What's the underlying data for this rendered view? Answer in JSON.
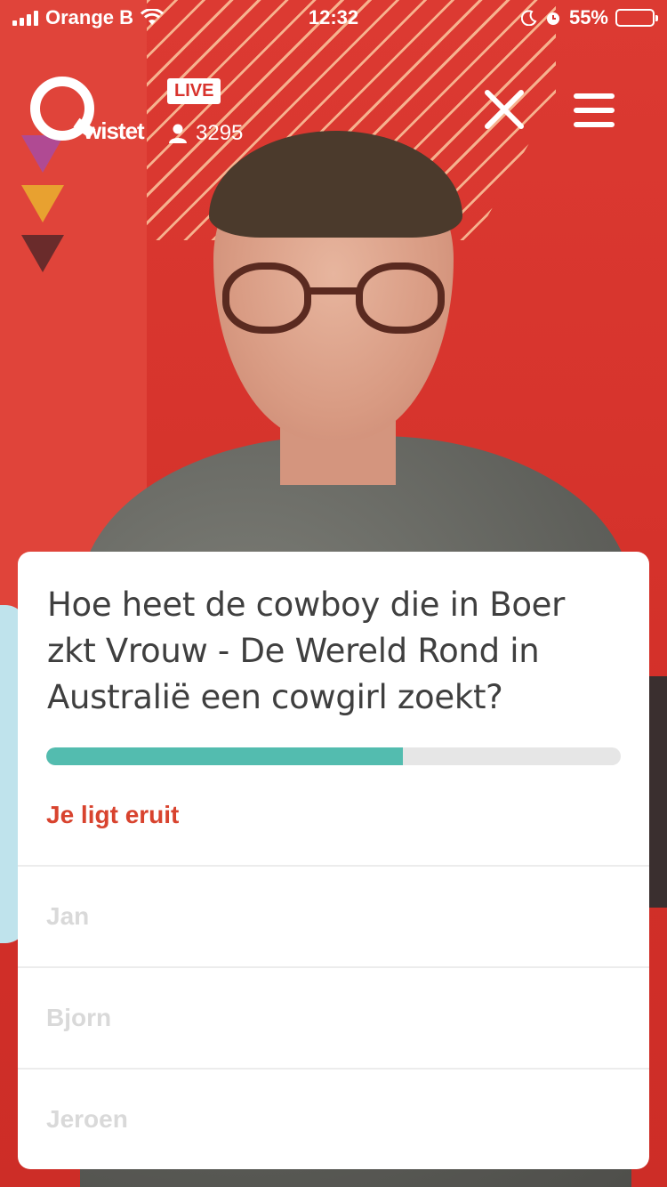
{
  "status_bar": {
    "carrier": "Orange B",
    "time": "12:32",
    "battery": "55%",
    "battery_level": 0.55,
    "icons": [
      "signal-icon",
      "wifi-icon",
      "moon-icon",
      "alarm-icon",
      "battery-icon"
    ]
  },
  "overlay": {
    "logo_text": "wistet",
    "live_label": "LIVE",
    "viewer_count": "3295",
    "icons": [
      "close-icon",
      "menu-icon",
      "person-icon"
    ]
  },
  "quiz": {
    "question": "Hoe heet de cowboy die in Boer zkt Vrouw - De Wereld Rond in Australië een cowgirl zoekt?",
    "timer_progress": 0.62,
    "status": "Je ligt eruit",
    "answers": [
      "Jan",
      "Bjorn",
      "Jeroen"
    ]
  },
  "colors": {
    "brand_red": "#d8342e",
    "progress_teal": "#53bcaf",
    "status_red": "#d8432e",
    "answer_disabled": "#d9d9d9"
  }
}
